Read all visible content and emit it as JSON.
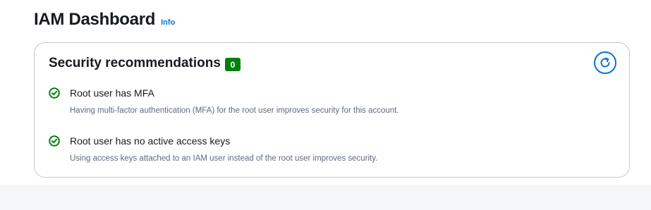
{
  "header": {
    "title": "IAM Dashboard",
    "info_label": "Info"
  },
  "security_card": {
    "title": "Security recommendations",
    "count": "0",
    "refresh_icon": "refresh-icon",
    "items": [
      {
        "status_icon": "check-circle-icon",
        "status": "success",
        "title": "Root user has MFA",
        "description": "Having multi-factor authentication (MFA) for the root user improves security for this account."
      },
      {
        "status_icon": "check-circle-icon",
        "status": "success",
        "title": "Root user has no active access keys",
        "description": "Using access keys attached to an IAM user instead of the root user improves security."
      }
    ]
  },
  "colors": {
    "accent": "#0972d3",
    "success": "#037f0c",
    "text_primary": "#16191f",
    "text_secondary": "#5f6b7a",
    "border": "#c6c6cd"
  }
}
